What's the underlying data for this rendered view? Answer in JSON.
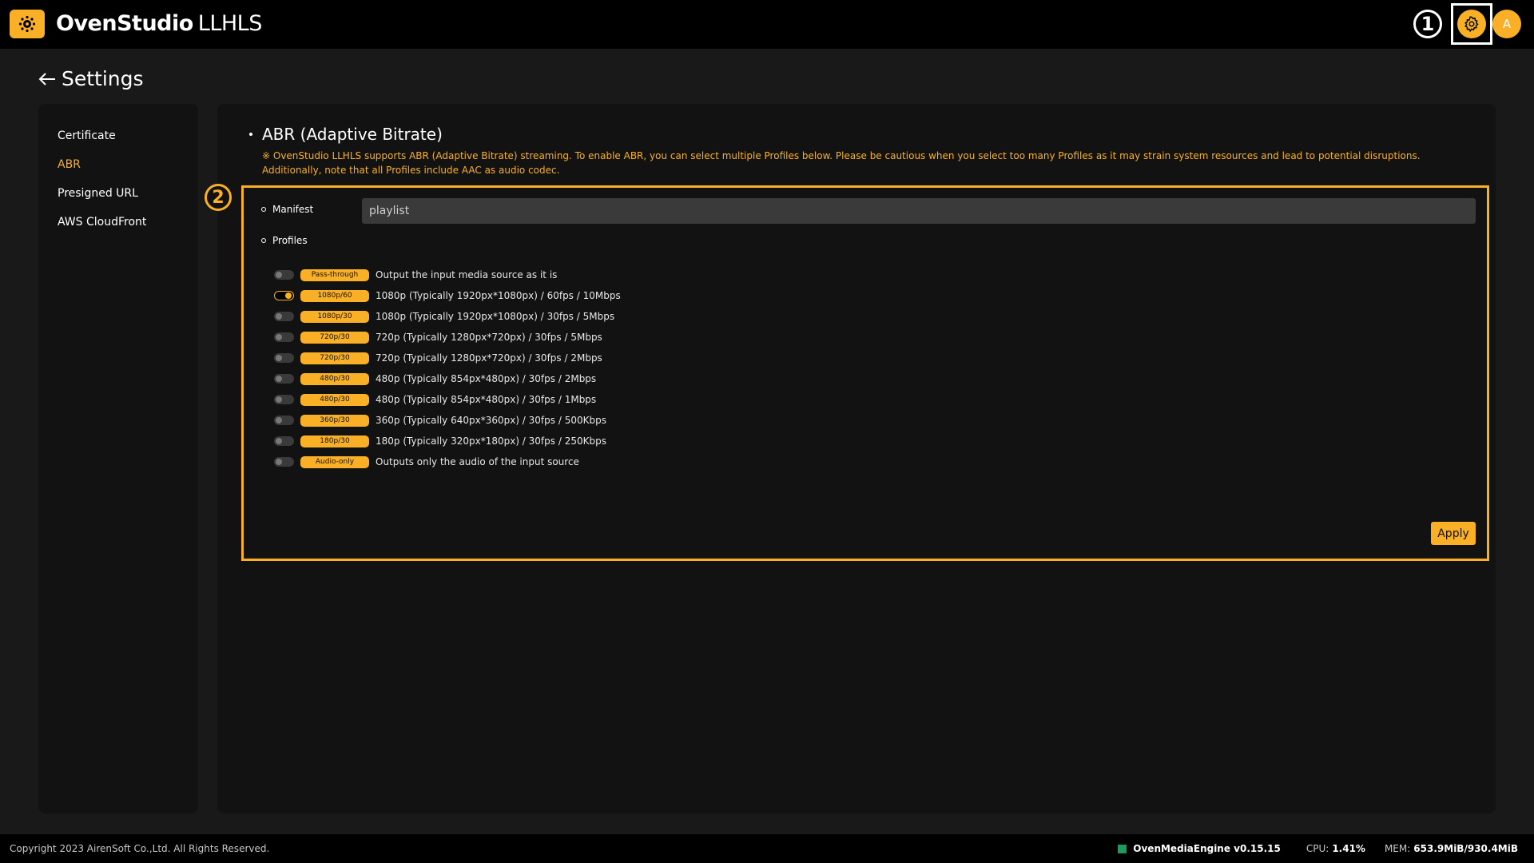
{
  "header": {
    "brand": "OvenStudio",
    "product": "LLHLS",
    "marker_1": "1",
    "avatar": "A",
    "accent_color": "#f9b026",
    "icons": {
      "logo": "oven-logo-icon",
      "settings": "gear-icon"
    }
  },
  "page": {
    "title": "Settings",
    "back_icon": "arrow-left-icon"
  },
  "sidebar": {
    "items": [
      {
        "label": "Certificate",
        "active": false
      },
      {
        "label": "ABR",
        "active": true
      },
      {
        "label": "Presigned URL",
        "active": false
      },
      {
        "label": "AWS CloudFront",
        "active": false
      }
    ]
  },
  "abr": {
    "title": "ABR (Adaptive Bitrate)",
    "notice": "※ OvenStudio LLHLS supports ABR (Adaptive Bitrate) streaming. To enable ABR, you can select multiple Profiles below. Please be cautious when you select too many Profiles as it may strain system resources and lead to potential disruptions. Additionally, note that all Profiles include AAC as audio codec.",
    "marker_2": "2",
    "manifest_label": "Manifest",
    "manifest_value": "playlist",
    "profiles_label": "Profiles",
    "profiles": [
      {
        "badge": "Pass-through",
        "desc": "Output the input media source as it is",
        "enabled": false
      },
      {
        "badge": "1080p/60",
        "desc": "1080p (Typically 1920px*1080px) / 60fps / 10Mbps",
        "enabled": true
      },
      {
        "badge": "1080p/30",
        "desc": "1080p (Typically 1920px*1080px) / 30fps / 5Mbps",
        "enabled": false
      },
      {
        "badge": "720p/30",
        "desc": "720p (Typically 1280px*720px) / 30fps / 5Mbps",
        "enabled": false
      },
      {
        "badge": "720p/30",
        "desc": "720p (Typically 1280px*720px) / 30fps / 2Mbps",
        "enabled": false
      },
      {
        "badge": "480p/30",
        "desc": "480p (Typically 854px*480px) / 30fps / 2Mbps",
        "enabled": false
      },
      {
        "badge": "480p/30",
        "desc": "480p (Typically 854px*480px) / 30fps / 1Mbps",
        "enabled": false
      },
      {
        "badge": "360p/30",
        "desc": "360p (Typically 640px*360px) / 30fps / 500Kbps",
        "enabled": false
      },
      {
        "badge": "180p/30",
        "desc": "180p (Typically 320px*180px) / 30fps / 250Kbps",
        "enabled": false
      },
      {
        "badge": "Audio-only",
        "desc": "Outputs only the audio of the input source",
        "enabled": false
      }
    ],
    "apply_label": "Apply"
  },
  "footer": {
    "copyright": "Copyright 2023 AirenSoft Co.,Ltd. All Rights Reserved.",
    "engine": "OvenMediaEngine v0.15.15",
    "engine_status_color": "#1a9e5a",
    "cpu_label": "CPU:",
    "cpu_value": "1.41%",
    "mem_label": "MEM:",
    "mem_value": "653.9MiB/930.4MiB"
  }
}
